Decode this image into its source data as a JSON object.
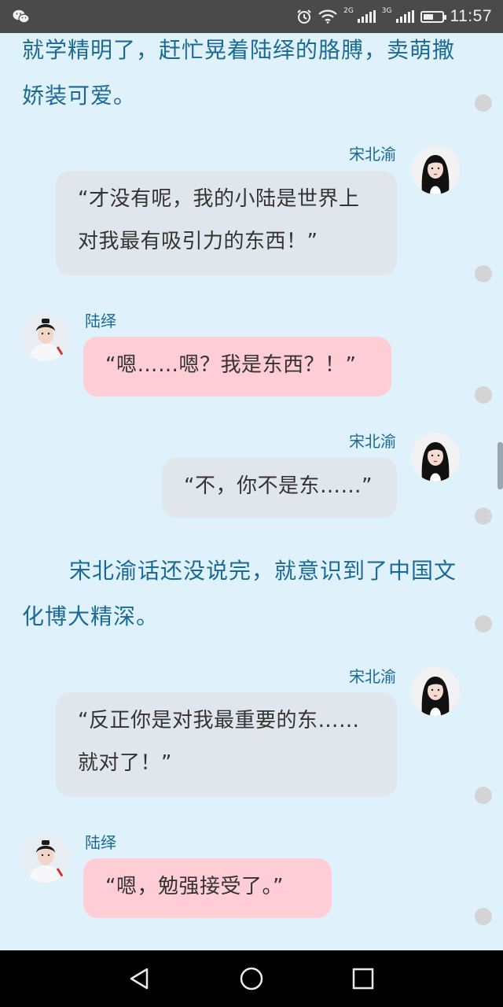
{
  "status_bar": {
    "time": "11:57",
    "network_1": "2G",
    "network_2": "3G",
    "battery_level": 0.55,
    "icons": [
      "wechat-icon",
      "alarm-icon",
      "wifi-icon",
      "signal-icon",
      "battery-icon"
    ]
  },
  "narration": {
    "top": "就学精明了，赶忙晃着陆绎的胳膊，卖萌撒娇装可爱。",
    "middle": "宋北渝话还没说完，就意识到了中国文化博大精深。"
  },
  "messages": [
    {
      "speaker": "宋北渝",
      "side": "right",
      "text": "“才没有呢，我的小陆是世界上对我最有吸引力的东西！”"
    },
    {
      "speaker": "陆绎",
      "side": "left",
      "text": "“嗯……嗯？我是东西？！”"
    },
    {
      "speaker": "宋北渝",
      "side": "right",
      "text": "“不，你不是东……”"
    },
    {
      "speaker": "宋北渝",
      "side": "right",
      "text": "“反正你是对我最重要的东……就对了！”"
    },
    {
      "speaker": "陆绎",
      "side": "left",
      "text": "“嗯，勉强接受了。”"
    }
  ],
  "nav_bar": {
    "buttons": [
      "back-icon",
      "home-icon",
      "recents-icon"
    ]
  }
}
